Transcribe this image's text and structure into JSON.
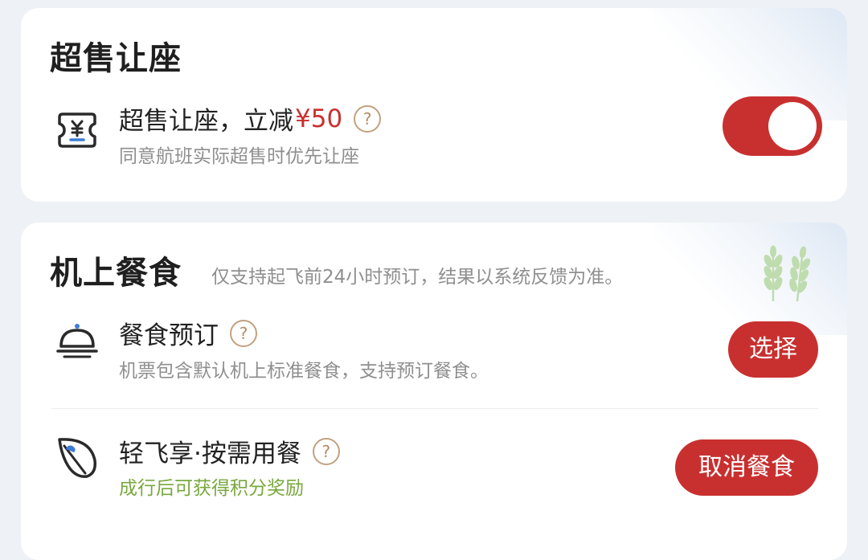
{
  "oversell": {
    "title": "超售让座",
    "row": {
      "title_prefix": "超售让座，立减",
      "price": "¥50",
      "help": "?",
      "desc": "同意航班实际超售时优先让座",
      "toggle_on": true
    }
  },
  "meal": {
    "title": "机上餐食",
    "subtitle": "仅支持起飞前24小时预订，结果以系统反馈为准。",
    "items": [
      {
        "title": "餐食预订",
        "help": "?",
        "desc": "机票包含默认机上标准餐食，支持预订餐食。",
        "button": "选择"
      },
      {
        "title": "轻飞享·按需用餐",
        "help": "?",
        "desc": "成行后可获得积分奖励",
        "button": "取消餐食"
      }
    ]
  },
  "colors": {
    "accent": "#c8302f",
    "green_text": "#79a83e",
    "help_icon": "#b88a62"
  },
  "icons": [
    "ticket-yen-icon",
    "question-icon",
    "food-cloche-icon",
    "leaf-icon",
    "wheat-icon"
  ]
}
